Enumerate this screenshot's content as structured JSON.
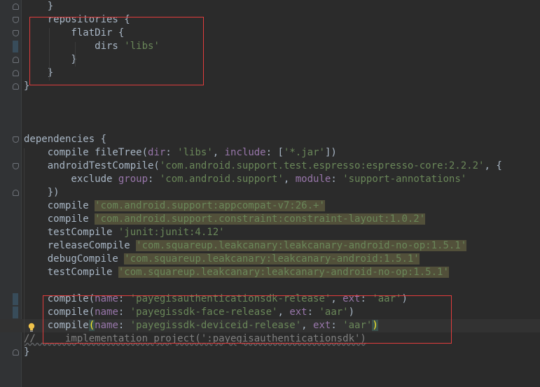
{
  "lines": [
    [
      {
        "t": "    }",
        "c": ""
      }
    ],
    [
      {
        "t": "    repositories {",
        "c": ""
      }
    ],
    [
      {
        "t": "        flatDir {",
        "c": ""
      }
    ],
    [
      {
        "t": "            dirs ",
        "c": ""
      },
      {
        "t": "'libs'",
        "c": "str"
      }
    ],
    [
      {
        "t": "        }",
        "c": ""
      }
    ],
    [
      {
        "t": "    }",
        "c": ""
      }
    ],
    [
      {
        "t": "}",
        "c": ""
      }
    ],
    [
      {
        "t": "",
        "c": ""
      }
    ],
    [
      {
        "t": "",
        "c": ""
      }
    ],
    [
      {
        "t": "",
        "c": ""
      }
    ],
    [
      {
        "t": "dependencies {",
        "c": ""
      }
    ],
    [
      {
        "t": "    compile fileTree(",
        "c": ""
      },
      {
        "t": "dir",
        "c": "param"
      },
      {
        "t": ": ",
        "c": ""
      },
      {
        "t": "'libs'",
        "c": "str"
      },
      {
        "t": ", ",
        "c": ""
      },
      {
        "t": "include",
        "c": "param"
      },
      {
        "t": ": [",
        "c": ""
      },
      {
        "t": "'*.jar'",
        "c": "str"
      },
      {
        "t": "])",
        "c": ""
      }
    ],
    [
      {
        "t": "    androidTestCompile(",
        "c": ""
      },
      {
        "t": "'com.android.support.test.espresso:espresso-core:2.2.2'",
        "c": "str"
      },
      {
        "t": ", {",
        "c": ""
      }
    ],
    [
      {
        "t": "        exclude ",
        "c": ""
      },
      {
        "t": "group",
        "c": "param"
      },
      {
        "t": ": ",
        "c": ""
      },
      {
        "t": "'com.android.support'",
        "c": "str"
      },
      {
        "t": ", ",
        "c": ""
      },
      {
        "t": "module",
        "c": "param"
      },
      {
        "t": ": ",
        "c": ""
      },
      {
        "t": "'support-annotations'",
        "c": "str"
      }
    ],
    [
      {
        "t": "    })",
        "c": ""
      }
    ],
    [
      {
        "t": "    compile ",
        "c": ""
      },
      {
        "t": "'com.android.support:appcompat-v7:26.+'",
        "c": "str hl"
      }
    ],
    [
      {
        "t": "    compile ",
        "c": ""
      },
      {
        "t": "'com.android.support.constraint:constraint-layout:1.0.2'",
        "c": "str hl"
      }
    ],
    [
      {
        "t": "    testCompile ",
        "c": ""
      },
      {
        "t": "'junit:junit:4.12'",
        "c": "str"
      }
    ],
    [
      {
        "t": "    releaseCompile ",
        "c": ""
      },
      {
        "t": "'com.squareup.leakcanary:leakcanary-android-no-op:1.5.1'",
        "c": "str hl"
      }
    ],
    [
      {
        "t": "    debugCompile ",
        "c": ""
      },
      {
        "t": "'com.squareup.leakcanary:leakcanary-android:1.5.1'",
        "c": "str hl"
      }
    ],
    [
      {
        "t": "    testCompile ",
        "c": ""
      },
      {
        "t": "'com.squareup.leakcanary:leakcanary-android-no-op:1.5.1'",
        "c": "str hl"
      }
    ],
    [
      {
        "t": "",
        "c": ""
      }
    ],
    [
      {
        "t": "    compile(",
        "c": ""
      },
      {
        "t": "name",
        "c": "param"
      },
      {
        "t": ": ",
        "c": ""
      },
      {
        "t": "'payegisauthenticationsdk-release'",
        "c": "str"
      },
      {
        "t": ", ",
        "c": ""
      },
      {
        "t": "ext",
        "c": "param"
      },
      {
        "t": ": ",
        "c": ""
      },
      {
        "t": "'aar'",
        "c": "str"
      },
      {
        "t": ")",
        "c": ""
      }
    ],
    [
      {
        "t": "    compile(",
        "c": ""
      },
      {
        "t": "name",
        "c": "param"
      },
      {
        "t": ": ",
        "c": ""
      },
      {
        "t": "'payegissdk-face-release'",
        "c": "str"
      },
      {
        "t": ", ",
        "c": ""
      },
      {
        "t": "ext",
        "c": "param"
      },
      {
        "t": ": ",
        "c": ""
      },
      {
        "t": "'aar'",
        "c": "str"
      },
      {
        "t": ")",
        "c": ""
      }
    ],
    [
      {
        "t": "    compile",
        "c": ""
      },
      {
        "t": "(",
        "c": "brace-match"
      },
      {
        "t": "name",
        "c": "param"
      },
      {
        "t": ": ",
        "c": ""
      },
      {
        "t": "'payegissdk-deviceid-release'",
        "c": "str"
      },
      {
        "t": ", ",
        "c": ""
      },
      {
        "t": "ext",
        "c": "param"
      },
      {
        "t": ": ",
        "c": ""
      },
      {
        "t": "'aar'",
        "c": "str"
      },
      {
        "t": ")",
        "c": "brace-match"
      }
    ],
    [
      {
        "t": "//     implementation project(':payegisauthenticationsdk')",
        "c": "cm squig"
      }
    ],
    [
      {
        "t": "}",
        "c": ""
      }
    ]
  ],
  "current_line": 24,
  "colors": {
    "background": "#2b2b2b",
    "string": "#6a8759",
    "parameter": "#9876aa",
    "comment": "#808080",
    "highlight_box": "#e23d3d",
    "string_highlight": "#52503a"
  },
  "icons": {
    "intention_bulb": "lightbulb-icon"
  }
}
